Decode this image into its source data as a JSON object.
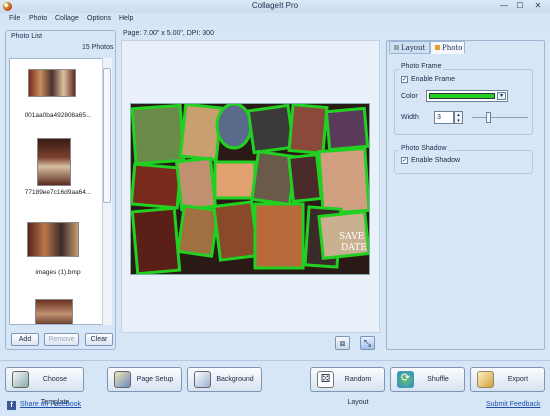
{
  "window": {
    "title": "CollageIt Pro",
    "min": "—",
    "max": "☐",
    "close": "✕"
  },
  "menu": [
    "File",
    "Photo",
    "Collage",
    "Options",
    "Help"
  ],
  "photo_list": {
    "title": "Photo List",
    "count": "15 Photos",
    "items": [
      {
        "label": "001aa0ba492808a65..."
      },
      {
        "label": "77189ee7c16d9aa64..."
      },
      {
        "label": "images (1).bmp"
      },
      {
        "label": ""
      }
    ],
    "buttons": {
      "add": "Add",
      "remove": "Remove",
      "clear": "Clear"
    }
  },
  "page_info": "Page:  7.00\" x 5.00\", DPI: 300",
  "tabs": {
    "layout": "Layout",
    "photo": "Photo"
  },
  "photo_frame": {
    "title": "Photo Frame",
    "enable_label": "Enable Frame",
    "color_label": "Color",
    "color_value": "#22d022",
    "width_label": "Width",
    "width_value": "3"
  },
  "photo_shadow": {
    "title": "Photo Shadow",
    "enable_label": "Enable Shadow"
  },
  "bottom_buttons": {
    "choose_template": "Choose Template",
    "page_setup": "Page Setup",
    "background": "Background",
    "random_layout": "Random Layout",
    "shuffle": "Shuffle",
    "export": "Export"
  },
  "links": {
    "facebook": "Share on Facebook",
    "feedback": "Submit Feedback"
  }
}
